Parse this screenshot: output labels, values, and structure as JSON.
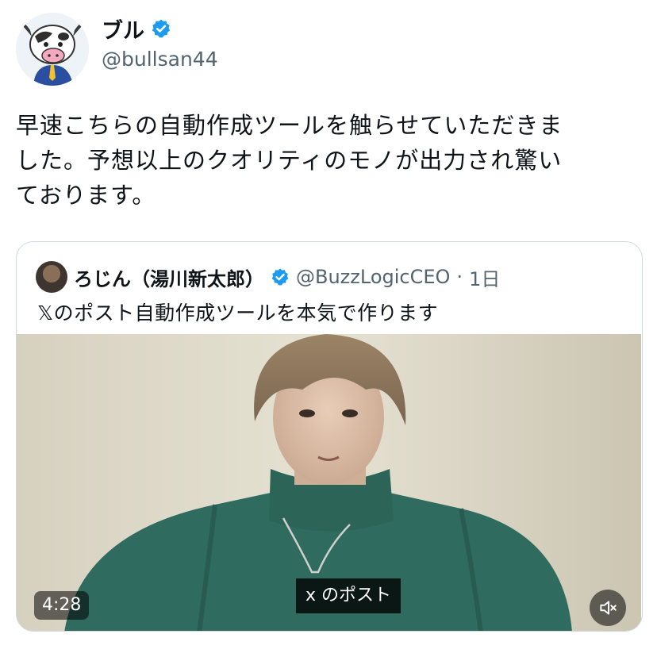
{
  "post": {
    "display_name": "ブル",
    "handle": "@bullsan44",
    "text_lines": [
      "早速こちらの自動作成ツールを触らせていただきま",
      "した。予想以上のクオリティのモノが出力され驚い",
      "ております。"
    ]
  },
  "quote": {
    "display_name": "ろじん（湯川新太郎）",
    "handle": "@BuzzLogicCEO",
    "separator": "·",
    "time": "1日",
    "text": "𝕏のポスト自動作成ツールを本気で作ります",
    "video": {
      "duration": "4:28",
      "caption": "x のポスト"
    }
  },
  "icons": {
    "verified": "verified-badge-icon",
    "mute": "speaker-muted-icon"
  },
  "colors": {
    "verified": "#1d9bf0",
    "secondary_text": "#536471",
    "border": "#cfd9de"
  }
}
